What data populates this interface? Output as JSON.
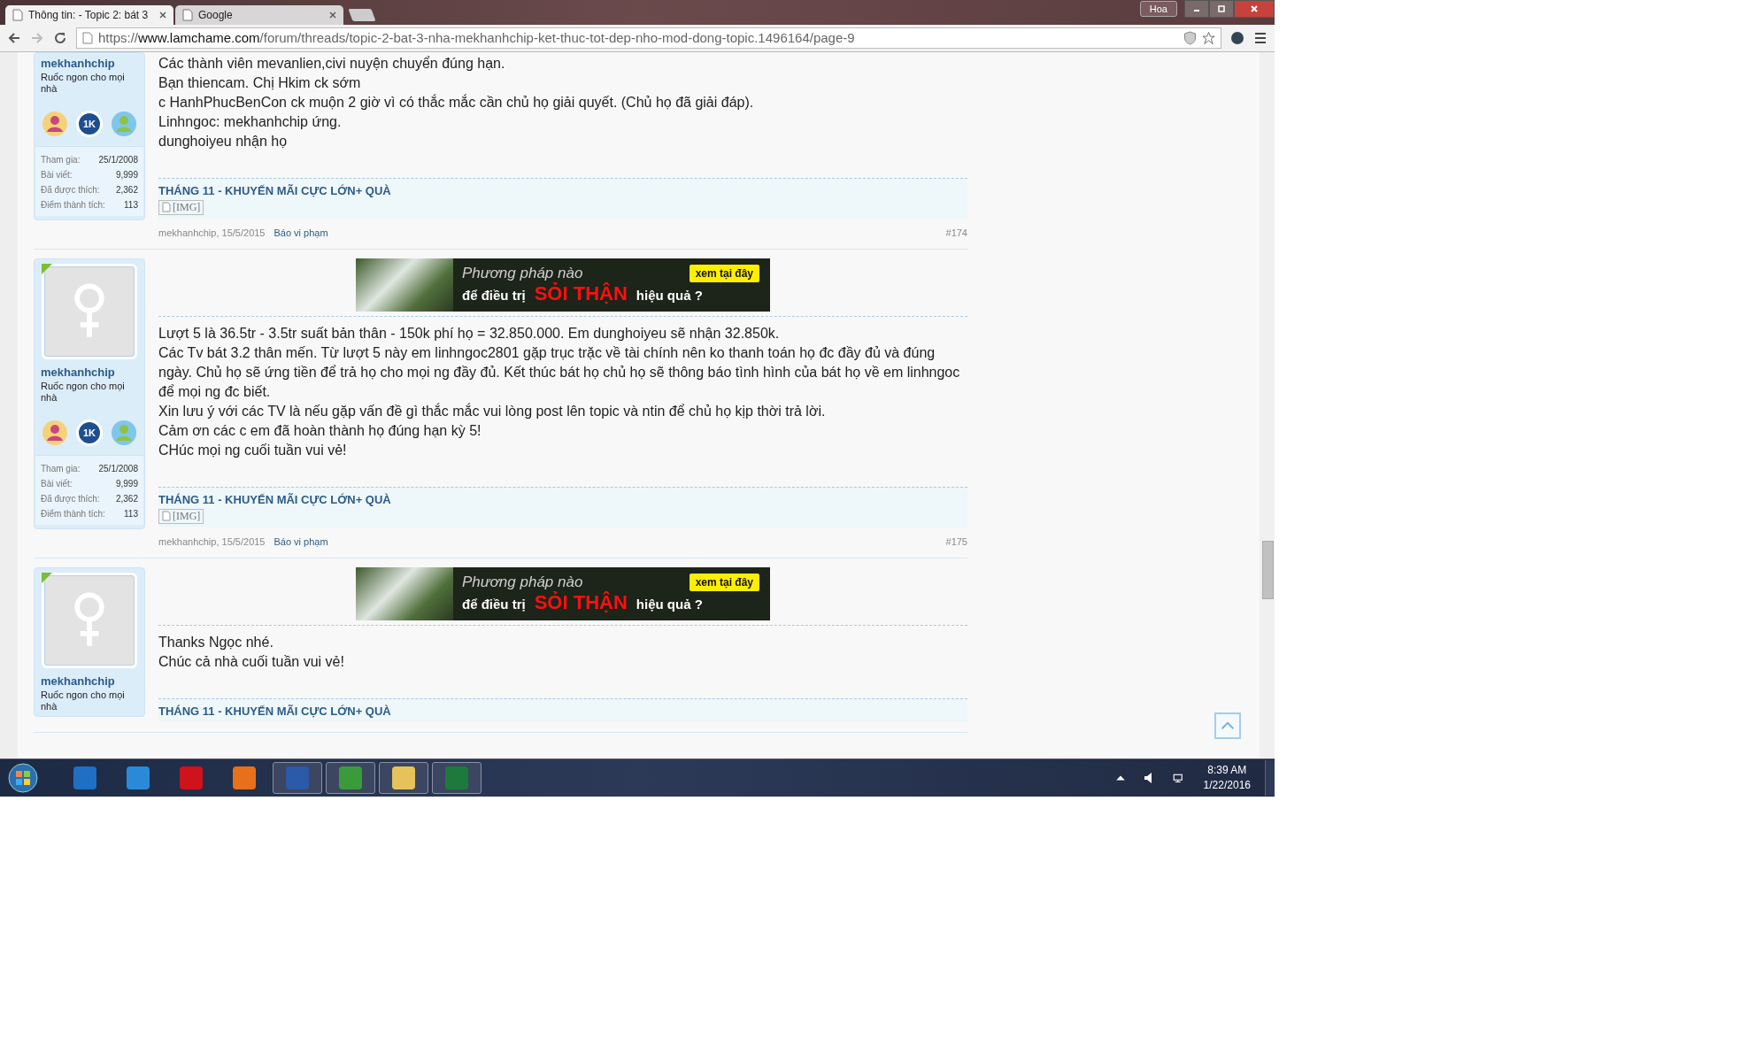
{
  "tabs": [
    {
      "title": "Thông tin: - Topic 2: bát 3",
      "selected": true
    },
    {
      "title": "Google",
      "selected": false
    }
  ],
  "profile_label": "Hoa",
  "address": {
    "scheme": "https://",
    "host": "www.lamchame.com",
    "path": "/forum/threads/topic-2-bat-3-nha-mekhanhchip-ket-thuc-tot-dep-nho-mod-dong-topic.1496164/page-9"
  },
  "posts": [
    {
      "user": {
        "name": "mekhanhchip",
        "title": "Ruốc ngon cho mọi nhà",
        "avatar": false,
        "badges": [
          {
            "kind": "people"
          },
          {
            "kind": "count",
            "text": "1K"
          },
          {
            "kind": "group"
          }
        ],
        "stats": [
          {
            "label": "Tham gia:",
            "value": "25/1/2008"
          },
          {
            "label": "Bài viết:",
            "value": "9,999"
          },
          {
            "label": "Đã được thích:",
            "value": "2,362"
          },
          {
            "label": "Điểm thành tích:",
            "value": "113"
          }
        ]
      },
      "message": [
        "Các thành viên mevanlien,civi nuyện chuyển đúng hạn.",
        "Bạn thiencam. Chị Hkim ck sớm",
        "c HanhPhucBenCon ck muộn 2 giờ vì có thắc mắc cần chủ họ giải quyết. (Chủ họ đã giải đáp).",
        "Linhngoc: mekhanhchip ứng.",
        "dunghoiyeu nhận họ"
      ],
      "signature": {
        "title": "THÁNG 11 - KHUYẾN MÃI CỰC LỚN+ QUÀ",
        "image": "[IMG]"
      },
      "meta": {
        "byline": "mekhanhchip, 15/5/2015",
        "report": "Báo vi phạm",
        "number": "#174"
      }
    },
    {
      "user": {
        "name": "mekhanhchip",
        "title": "Ruốc ngon cho mọi nhà",
        "avatar": true,
        "badges": [
          {
            "kind": "people"
          },
          {
            "kind": "count",
            "text": "1K"
          },
          {
            "kind": "group"
          }
        ],
        "stats": [
          {
            "label": "Tham gia:",
            "value": "25/1/2008"
          },
          {
            "label": "Bài viết:",
            "value": "9,999"
          },
          {
            "label": "Đã được thích:",
            "value": "2,362"
          },
          {
            "label": "Điểm thành tích:",
            "value": "113"
          }
        ]
      },
      "ad": {
        "line1": "Phương pháp nào",
        "line2": "để điều trị",
        "highlight": "SỎI THẬN",
        "line3": "hiệu quả ?",
        "button": "xem tại đây"
      },
      "message": [
        "Lượt 5 là 36.5tr - 3.5tr suất bản thân - 150k phí họ = 32.850.000. Em dunghoiyeu sẽ nhận 32.850k.",
        "Các Tv bát 3.2 thân mến. Từ lượt 5 này em linhngoc2801 gặp trục trặc về tài chính nên ko thanh toán họ đc đầy đủ và đúng ngày. Chủ họ sẽ ứng tiền để trả họ cho mọi ng đầy đủ. Kết thúc bát họ chủ họ sẽ thông báo tình hình của bát họ về em linhngoc để mọi ng đc biết.",
        "Xin lưu ý với các TV là nếu gặp vấn đề gì thắc mắc vui lòng post lên topic và ntin để chủ họ kịp thời trả lời.",
        "Cảm ơn các c em đã hoàn thành họ đúng hạn kỳ 5!",
        "CHúc mọi ng cuối tuần vui vẻ!"
      ],
      "signature": {
        "title": "THÁNG 11 - KHUYẾN MÃI CỰC LỚN+ QUÀ",
        "image": "[IMG]"
      },
      "meta": {
        "byline": "mekhanhchip, 15/5/2015",
        "report": "Báo vi phạm",
        "number": "#175"
      }
    },
    {
      "user": {
        "name": "mekhanhchip",
        "title": "Ruốc ngon cho mọi nhà",
        "avatar": true
      },
      "ad": {
        "line1": "Phương pháp nào",
        "line2": "để điều trị",
        "highlight": "SỎI THẬN",
        "line3": "hiệu quả ?",
        "button": "xem tại đây"
      },
      "message": [
        "Thanks Ngọc nhé.",
        "Chúc cả nhà cuối tuần vui vẻ!"
      ],
      "signature": {
        "title": "THÁNG 11 - KHUYẾN MÃI CỰC LỚN+ QUÀ"
      }
    }
  ],
  "taskbar": {
    "apps": [
      {
        "kind": "intel",
        "active": false
      },
      {
        "kind": "ie",
        "active": false
      },
      {
        "kind": "opera",
        "active": false
      },
      {
        "kind": "media",
        "active": false
      },
      {
        "kind": "word",
        "active": true
      },
      {
        "kind": "chrome",
        "active": true
      },
      {
        "kind": "folder",
        "active": true
      },
      {
        "kind": "excel",
        "active": true
      }
    ],
    "time": "8:39 AM",
    "date": "1/22/2016"
  }
}
